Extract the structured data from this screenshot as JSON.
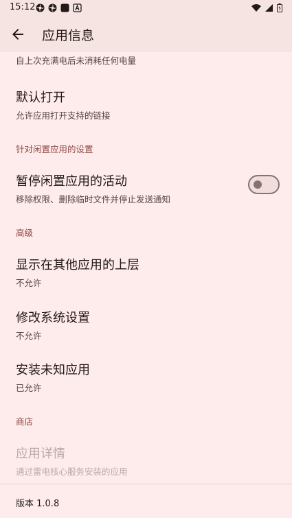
{
  "status_bar": {
    "time": "15:12",
    "left_icons": [
      "pinwheel-icon",
      "pinwheel-icon",
      "square-app-icon",
      "a-box-icon"
    ],
    "right_icons": [
      "wifi-icon",
      "signal-icon",
      "battery-icon"
    ]
  },
  "app_bar": {
    "title": "应用信息",
    "back_icon": "arrow-back-icon"
  },
  "battery_summary": "自上次充满电后未消耗任何电量",
  "open_by_default": {
    "title": "默认打开",
    "summary": "允许应用打开支持的链接"
  },
  "unused_apps_category": "针对闲置应用的设置",
  "pause_activity": {
    "title": "暂停闲置应用的活动",
    "summary": "移除权限、删除临时文件并停止发送通知",
    "enabled": false
  },
  "advanced_category": "高级",
  "display_over": {
    "title": "显示在其他应用的上层",
    "summary": "不允许"
  },
  "modify_settings": {
    "title": "修改系统设置",
    "summary": "不允许"
  },
  "install_unknown": {
    "title": "安装未知应用",
    "summary": "已允许"
  },
  "store_category": "商店",
  "app_details": {
    "title": "应用详情",
    "summary": "通过雷电核心服务安装的应用"
  },
  "version": "版本 1.0.8",
  "colors": {
    "background": "#fdeceb",
    "bar": "#f6e4e2",
    "accent": "#904a44",
    "outline": "#857371"
  }
}
